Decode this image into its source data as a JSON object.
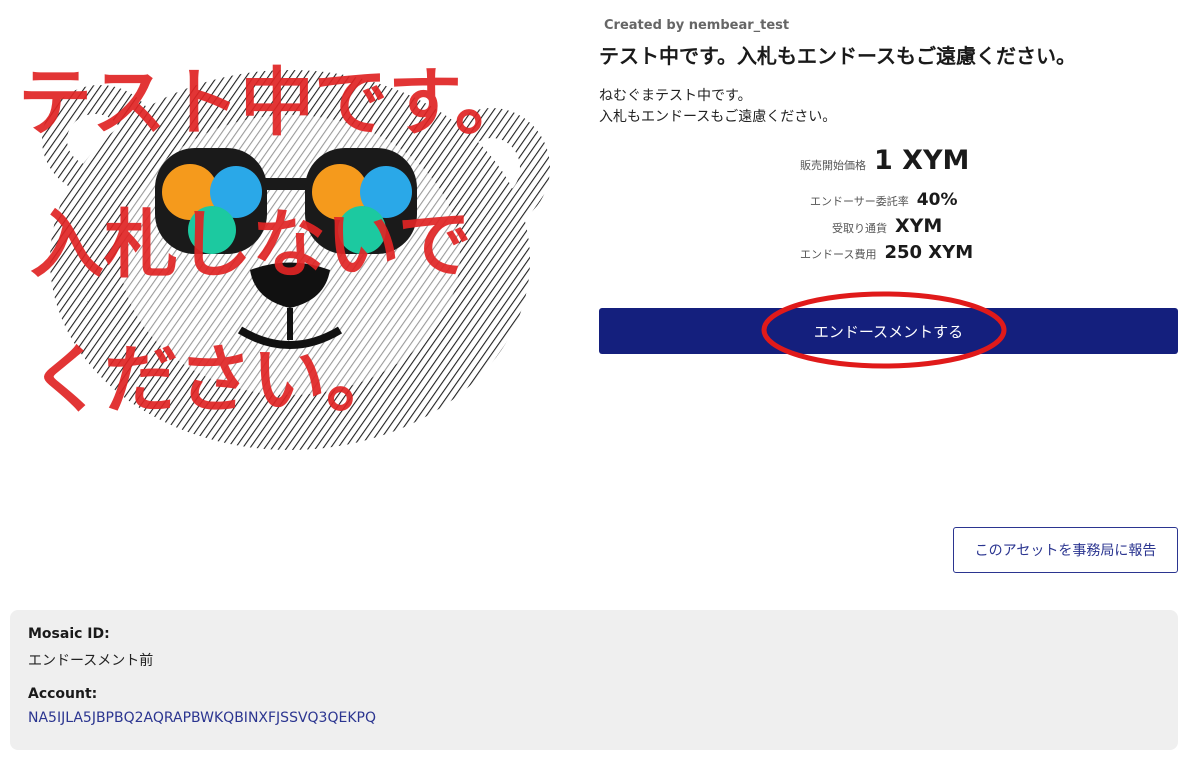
{
  "creator": {
    "prefix": "Created by",
    "name": "nembear_test"
  },
  "title": "テスト中です。入札もエンドースもご遠慮ください。",
  "description": [
    "ねむぐまテスト中です。",
    "入札もエンドースもご遠慮ください。"
  ],
  "artwork": {
    "overlay_lines": [
      "テスト中です。",
      "入札しないで",
      "ください。"
    ],
    "text_color": "#e02424",
    "glasses_colors": [
      "#f59a1c",
      "#2aa8e8",
      "#1cc9a0",
      "#1a1a1a"
    ]
  },
  "stats": {
    "start_price": {
      "label": "販売開始価格",
      "value": "1 XYM"
    },
    "commission": {
      "label": "エンドーサー委託率",
      "value": "40%"
    },
    "currency": {
      "label": "受取り通貨",
      "value": "XYM"
    },
    "endorse_fee": {
      "label": "エンドース費用",
      "value": "250 XYM"
    }
  },
  "endorse_button": {
    "label": "エンドースメントする",
    "color": "#141f7d",
    "highlight_color": "#e01a1a"
  },
  "report_button": {
    "label": "このアセットを事務局に報告"
  },
  "info": {
    "mosaic_id_label": "Mosaic ID:",
    "mosaic_id_value": "エンドースメント前",
    "account_label": "Account:",
    "account_value": "NA5IJLA5JBPBQ2AQRAPBWKQBINXFJSSVQ3QEKPQ"
  }
}
